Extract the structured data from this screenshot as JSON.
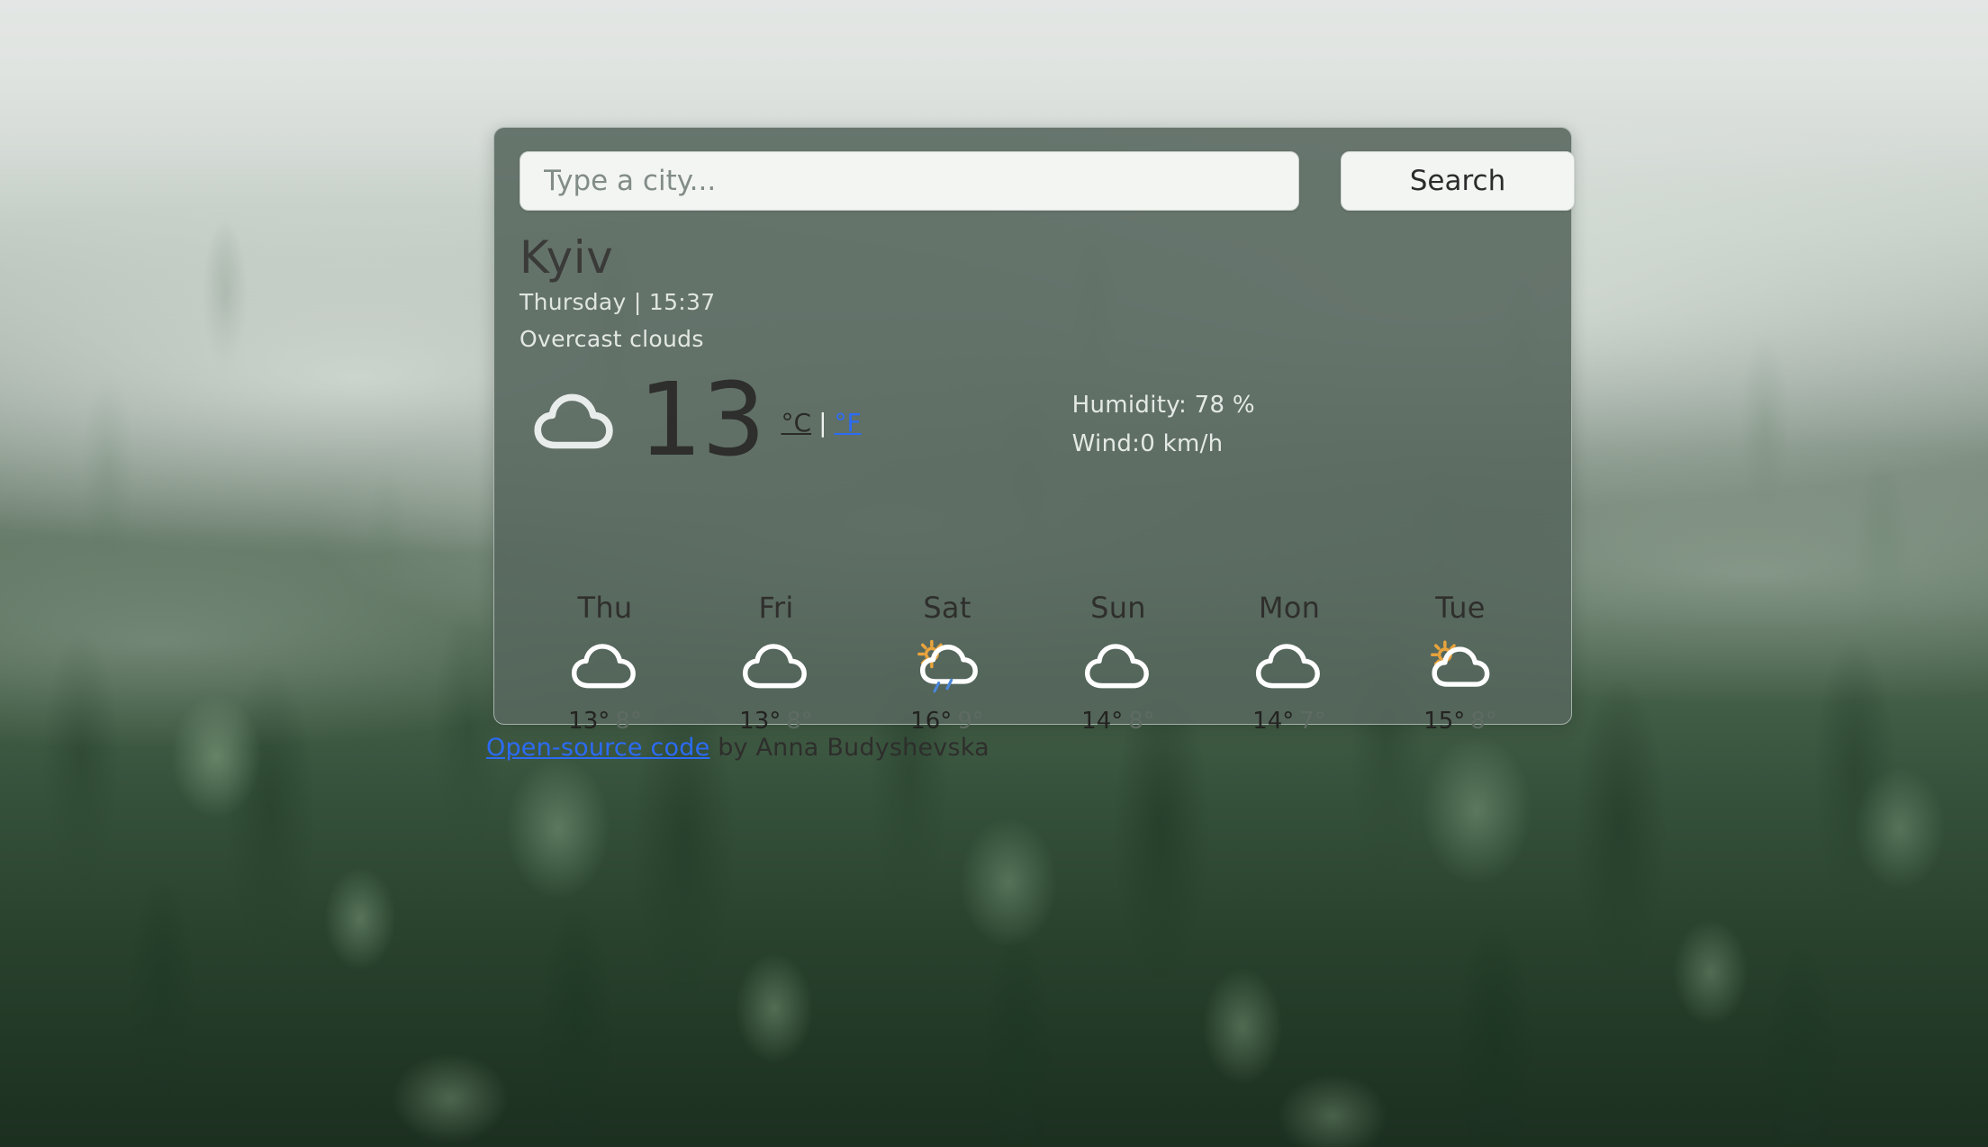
{
  "search": {
    "placeholder": "Type a city...",
    "value": "",
    "button_label": "Search"
  },
  "current": {
    "city": "Kyiv",
    "date_time": "Thursday | 15:37",
    "description": "Overcast clouds",
    "icon": "cloud-icon",
    "temperature": "13",
    "units": {
      "celsius_label": "°C",
      "separator": "|",
      "fahrenheit_label": "°F",
      "active": "celsius"
    },
    "humidity": "Humidity: 78 %",
    "wind": "Wind:0 km/h"
  },
  "forecast": [
    {
      "day": "Thu",
      "icon": "cloud-icon",
      "max": "13°",
      "min": "8°"
    },
    {
      "day": "Fri",
      "icon": "cloud-icon",
      "max": "13°",
      "min": "8°"
    },
    {
      "day": "Sat",
      "icon": "sun-cloud-rain-icon",
      "max": "16°",
      "min": "9°"
    },
    {
      "day": "Sun",
      "icon": "cloud-icon",
      "max": "14°",
      "min": "8°"
    },
    {
      "day": "Mon",
      "icon": "cloud-icon",
      "max": "14°",
      "min": "7°"
    },
    {
      "day": "Tue",
      "icon": "sun-cloud-icon",
      "max": "15°",
      "min": "8°"
    }
  ],
  "credit": {
    "link_text": "Open-source code",
    "author_text": " by Anna Budyshevska"
  },
  "colors": {
    "card_bg": "#56675d",
    "link_blue": "#2b6bf5",
    "sun_orange": "#e8a33c",
    "rain_blue": "#4a86d8",
    "cloud_white": "#ffffff",
    "dark_text": "#2e2e2c",
    "light_text": "#e4e9e5"
  }
}
